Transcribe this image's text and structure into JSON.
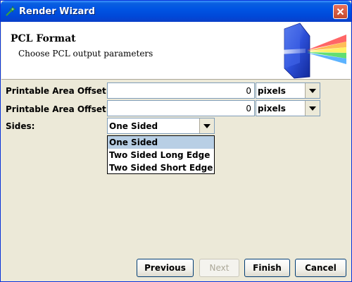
{
  "window": {
    "title": "Render Wizard",
    "icon": "wizard-app-icon",
    "close_icon": "close-icon"
  },
  "header": {
    "title": "PCL Format",
    "subtitle": "Choose PCL output parameters",
    "graphic": "prism-spectrum-graphic"
  },
  "form": {
    "offset_x": {
      "label": "Printable Area Offset X:",
      "value": "0",
      "unit": "pixels"
    },
    "offset_y": {
      "label": "Printable Area Offset Y:",
      "value": "0",
      "unit": "pixels"
    },
    "sides": {
      "label": "Sides:",
      "value": "One Sided",
      "options": [
        "One Sided",
        "Two Sided Long Edge",
        "Two Sided Short Edge"
      ],
      "highlighted": "One Sided"
    }
  },
  "buttons": {
    "previous": "Previous",
    "next": "Next",
    "finish": "Finish",
    "cancel": "Cancel"
  },
  "colors": {
    "titlebar": "#0054e3",
    "dialog_bg": "#ece9d8",
    "selection": "#b8cfe5",
    "field_border": "#7f9db9"
  }
}
